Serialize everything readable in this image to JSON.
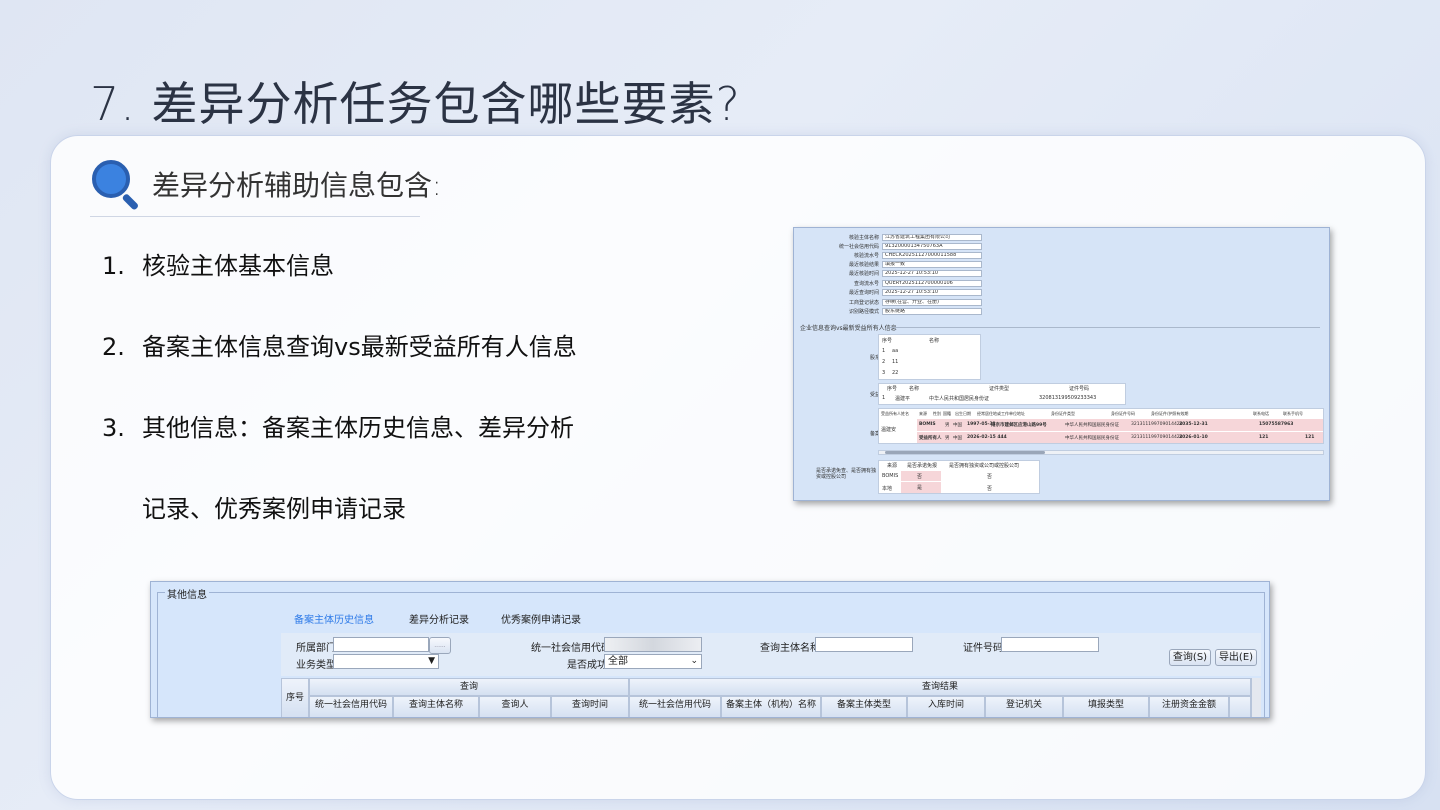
{
  "slide": {
    "title": "7. 差异分析任务包含哪些要素?",
    "subheading": "差异分析辅助信息包含:",
    "points": [
      {
        "num": "1.",
        "text": "核验主体基本信息"
      },
      {
        "num": "2.",
        "text": "备案主体信息查询vs最新受益所有人信息"
      },
      {
        "num": "3.",
        "text": "其他信息：备案主体历史信息、差异分析"
      },
      {
        "num": "",
        "text": "记录、优秀案例申请记录"
      }
    ]
  },
  "screenshot1": {
    "fields": [
      {
        "label": "核验主体名称",
        "value": "江苏省建筑工程集团有限公司"
      },
      {
        "label": "统一社会信用代码",
        "value": "91320000134750763A"
      },
      {
        "label": "核验流水号",
        "value": "CHECK20251127000011588"
      },
      {
        "label": "最近核验结果",
        "value": "填报一致"
      },
      {
        "label": "最近核验时间",
        "value": "2025-12-27 10:53:10"
      },
      {
        "label": "查询流水号",
        "value": "QUERY2025112700000106"
      },
      {
        "label": "最近查询时间",
        "value": "2025-12-27 10:53:10"
      },
      {
        "label": "工商登记状态",
        "value": "存续(在营、开业、在册)"
      },
      {
        "label": "识别路径模式",
        "value": "股东链路"
      }
    ],
    "section_title": "企业信息查询vs最新受益所有人信息",
    "gudong": {
      "label": "股东",
      "headers": [
        "序号",
        "名称"
      ],
      "rows": [
        [
          "1",
          "aa"
        ],
        [
          "2",
          "11"
        ],
        [
          "3",
          "22"
        ]
      ]
    },
    "shouyi": {
      "label": "受益",
      "headers": [
        "序号",
        "名称",
        "证件类型",
        "证件号码"
      ],
      "row": [
        "1",
        "温建平",
        "中华人民共和国居民身份证",
        "320813199509233343"
      ]
    },
    "beian": {
      "label": "备案",
      "headers": [
        "受益所有人姓名",
        "来源",
        "性别",
        "国籍",
        "出生日期",
        "经常居住地或工作单位地址",
        "身份证件类型",
        "身份证件号码",
        "身份证件/护照有效期",
        "联系电话",
        "联系手机号"
      ],
      "name": "温建安",
      "rows": [
        [
          "BOMIS",
          "男",
          "中国",
          "1997-05-31",
          "南京市建邺区应港山路99号",
          "中华人民共和国居民身份证",
          "321311199709014424",
          "2035-12-31",
          "15075587963",
          ""
        ],
        [
          "受益所有人",
          "男",
          "中国",
          "2026-02-15 444",
          "",
          "中华人民共和国居民身份证",
          "321311199709014424",
          "2026-01-10",
          "121",
          "121"
        ]
      ]
    },
    "bottom": {
      "left_label": "是否承诺免查、是否拥有独资或控股公司",
      "headers": [
        "来源",
        "是否承诺免报",
        "是否拥有独资或公司或控股公司"
      ],
      "rows": [
        [
          "BOMIS",
          "否",
          "否"
        ],
        [
          "本地",
          "是",
          "否"
        ]
      ]
    }
  },
  "screenshot2": {
    "legend": "其他信息",
    "tabs": [
      "备案主体历史信息",
      "差异分析记录",
      "优秀案例申请记录"
    ],
    "filters": {
      "dept_label": "所属部门",
      "dept_btn": "......",
      "code_label": "统一社会信用代码",
      "subject_label": "查询主体名称",
      "cert_label": "证件号码",
      "biz_label": "业务类型",
      "success_label": "是否成功",
      "success_value": "全部"
    },
    "buttons": {
      "query": "查询(S)",
      "export": "导出(E)"
    },
    "table": {
      "index_header": "序号",
      "group_query": "查询",
      "group_result": "查询结果",
      "query_cols": [
        "统一社会信用代码",
        "查询主体名称",
        "查询人",
        "查询时间"
      ],
      "result_cols": [
        "统一社会信用代码",
        "备案主体（机构）名称",
        "备案主体类型",
        "入库时间",
        "登记机关",
        "填报类型",
        "注册资金金额"
      ]
    }
  }
}
